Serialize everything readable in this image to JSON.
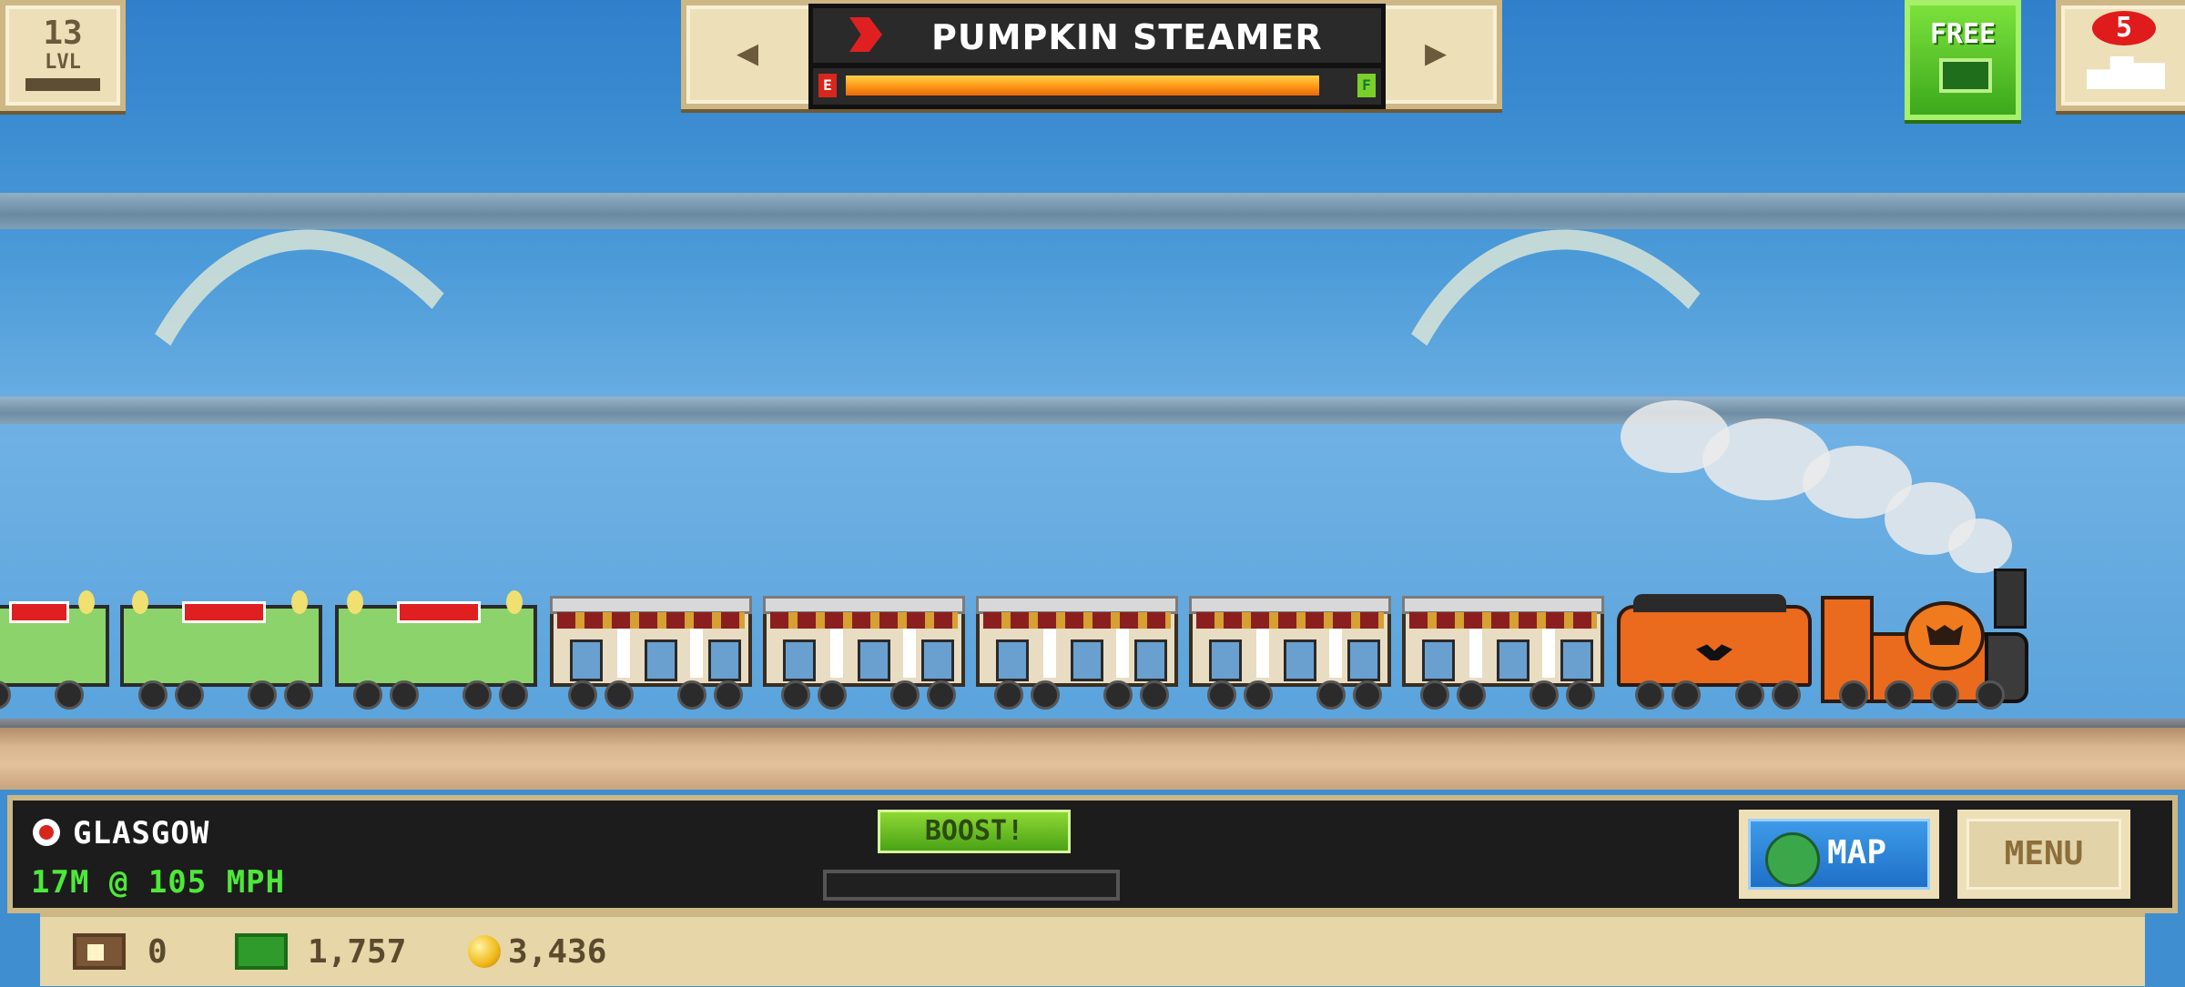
{
  "level": {
    "number": "13",
    "label": "LVL"
  },
  "train_selector": {
    "title": "PUMPKIN STEAMER",
    "prev_arrow": "◀",
    "next_arrow": "▶",
    "fuel": {
      "empty_label": "E",
      "full_label": "F",
      "level": 0.96
    }
  },
  "free_button": {
    "label": "FREE"
  },
  "notifications": {
    "count": "5"
  },
  "hud": {
    "station": "GLASGOW",
    "distance_speed": "17M @ 105 MPH",
    "boost_label": "BOOST!",
    "map_label": "MAP",
    "menu_label": "MENU"
  },
  "currencies": {
    "tickets": "0",
    "cash": "1,757",
    "coins": "3,436"
  },
  "colors": {
    "fuel": "#ff9b1a",
    "free_button": "#4ec11f",
    "speed_text": "#4ee83a",
    "engine": "#ea6a1e",
    "notification_badge": "#e01b1b"
  },
  "icons": [
    "train-icon",
    "station-icon",
    "globe-icon",
    "ticket-icon",
    "cash-icon",
    "coin-icon"
  ]
}
